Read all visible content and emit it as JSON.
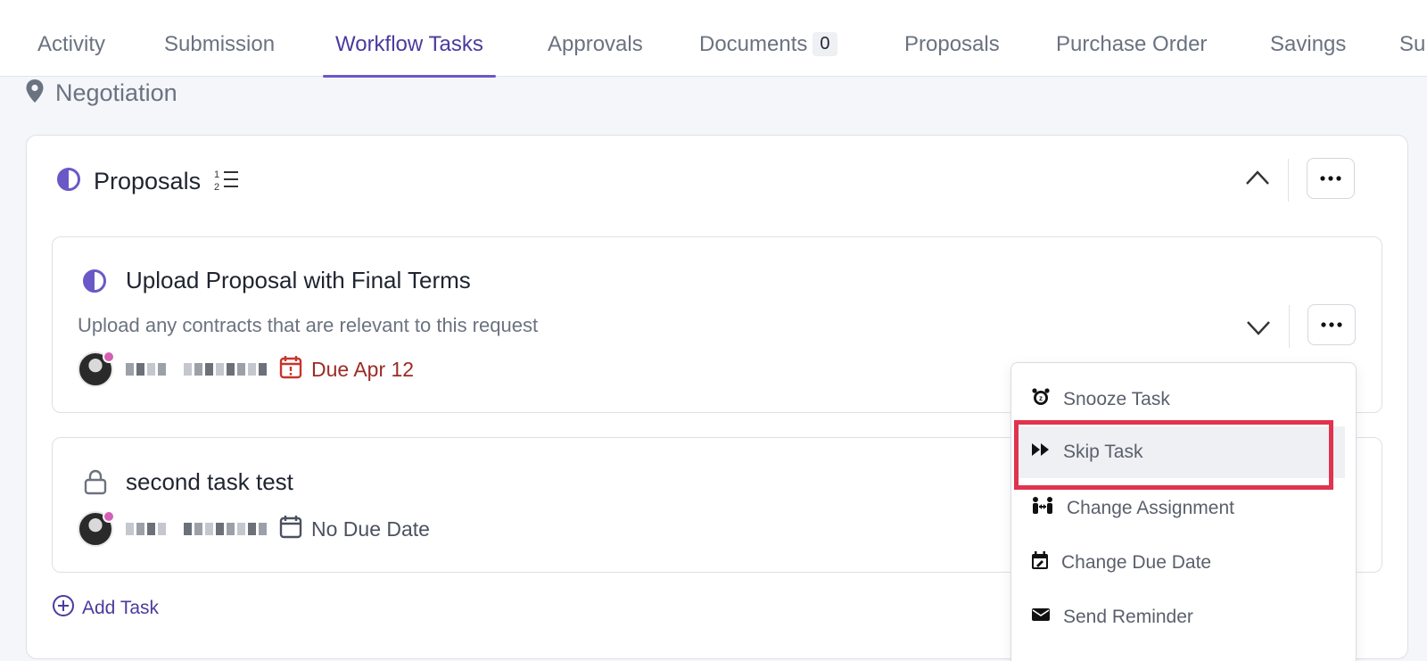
{
  "tabs": [
    {
      "label": "Activity"
    },
    {
      "label": "Submission"
    },
    {
      "label": "Workflow Tasks",
      "active": true
    },
    {
      "label": "Approvals"
    },
    {
      "label": "Documents",
      "count": "0"
    },
    {
      "label": "Proposals"
    },
    {
      "label": "Purchase Order"
    },
    {
      "label": "Savings"
    },
    {
      "label": "Su"
    }
  ],
  "stage": {
    "label": "Negotiation"
  },
  "section": {
    "title": "Proposals"
  },
  "tasks": [
    {
      "title": "Upload Proposal with Final Terms",
      "description": "Upload any contracts that are relevant to this request",
      "due": "Due Apr 12",
      "status": "in-progress"
    },
    {
      "title": "second task test",
      "due": "No Due Date",
      "status": "locked"
    }
  ],
  "add_task_label": "Add Task",
  "menu": {
    "items": [
      {
        "label": "Snooze Task",
        "icon": "alarm-clock-icon"
      },
      {
        "label": "Skip Task",
        "icon": "fast-forward-icon",
        "highlighted": true
      },
      {
        "label": "Change Assignment",
        "icon": "people-swap-icon"
      },
      {
        "label": "Change Due Date",
        "icon": "calendar-edit-icon"
      },
      {
        "label": "Send Reminder",
        "icon": "envelope-icon"
      }
    ]
  },
  "colors": {
    "accent": "#6b58c7",
    "due_overdue": "#9b2b24",
    "highlight_border": "#e0334f"
  }
}
